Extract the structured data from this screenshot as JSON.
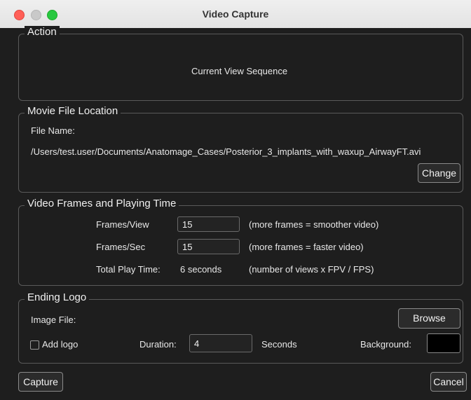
{
  "window": {
    "title": "Video Capture"
  },
  "action": {
    "legend": "Action",
    "value": "Current View Sequence"
  },
  "movie": {
    "legend": "Movie File Location",
    "file_name_label": "File Name:",
    "file_path": "/Users/test.user/Documents/Anatomage_Cases/Posterior_3_implants_with_waxup_AirwayFT.avi",
    "change_label": "Change"
  },
  "frames": {
    "legend": "Video Frames and Playing Time",
    "frames_per_view_label": "Frames/View",
    "frames_per_view_value": "15",
    "frames_per_view_note": "(more frames = smoother video)",
    "frames_per_sec_label": "Frames/Sec",
    "frames_per_sec_value": "15",
    "frames_per_sec_note": "(more frames = faster video)",
    "total_play_label": "Total Play Time:",
    "total_play_value": "6 seconds",
    "total_play_note": "(number of views x FPV / FPS)"
  },
  "logo": {
    "legend": "Ending Logo",
    "image_file_label": "Image File:",
    "browse_label": "Browse",
    "add_logo_label": "Add logo",
    "add_logo_checked": false,
    "duration_label": "Duration:",
    "duration_value": "4",
    "seconds_label": "Seconds",
    "background_label": "Background:",
    "background_color": "#000000"
  },
  "footer": {
    "capture_label": "Capture",
    "cancel_label": "Cancel"
  }
}
